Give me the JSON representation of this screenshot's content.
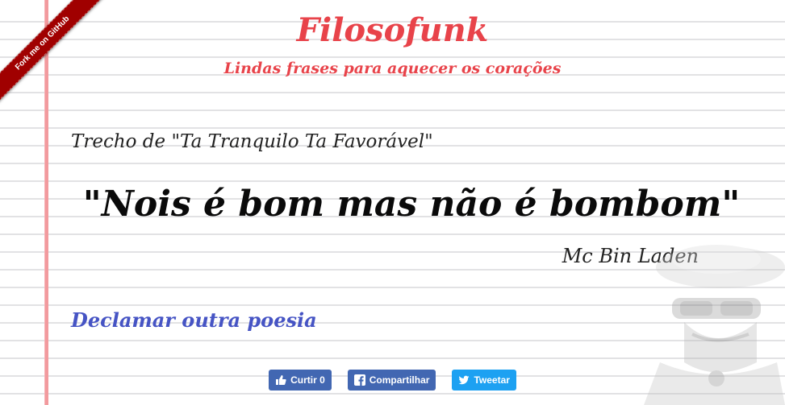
{
  "ribbon": {
    "label": "Fork me on GitHub"
  },
  "header": {
    "title": "Filosofunk",
    "subtitle": "Lindas frases para aquecer os corações"
  },
  "poem": {
    "excerpt": "Trecho de \"Ta Tranquilo Ta Favorável\"",
    "quote": "\"Nois é bom mas não é bombom\"",
    "author": "Mc Bin Laden"
  },
  "actions": {
    "declare_label": "Declamar outra poesia"
  },
  "share": {
    "like_label": "Curtir 0",
    "share_label": "Compartilhar",
    "tweet_label": "Tweetar"
  },
  "colors": {
    "title": "#e8434a",
    "link": "#4654c4",
    "facebook": "#4267b2",
    "twitter": "#1da1f2",
    "ribbon": "#a00000"
  }
}
